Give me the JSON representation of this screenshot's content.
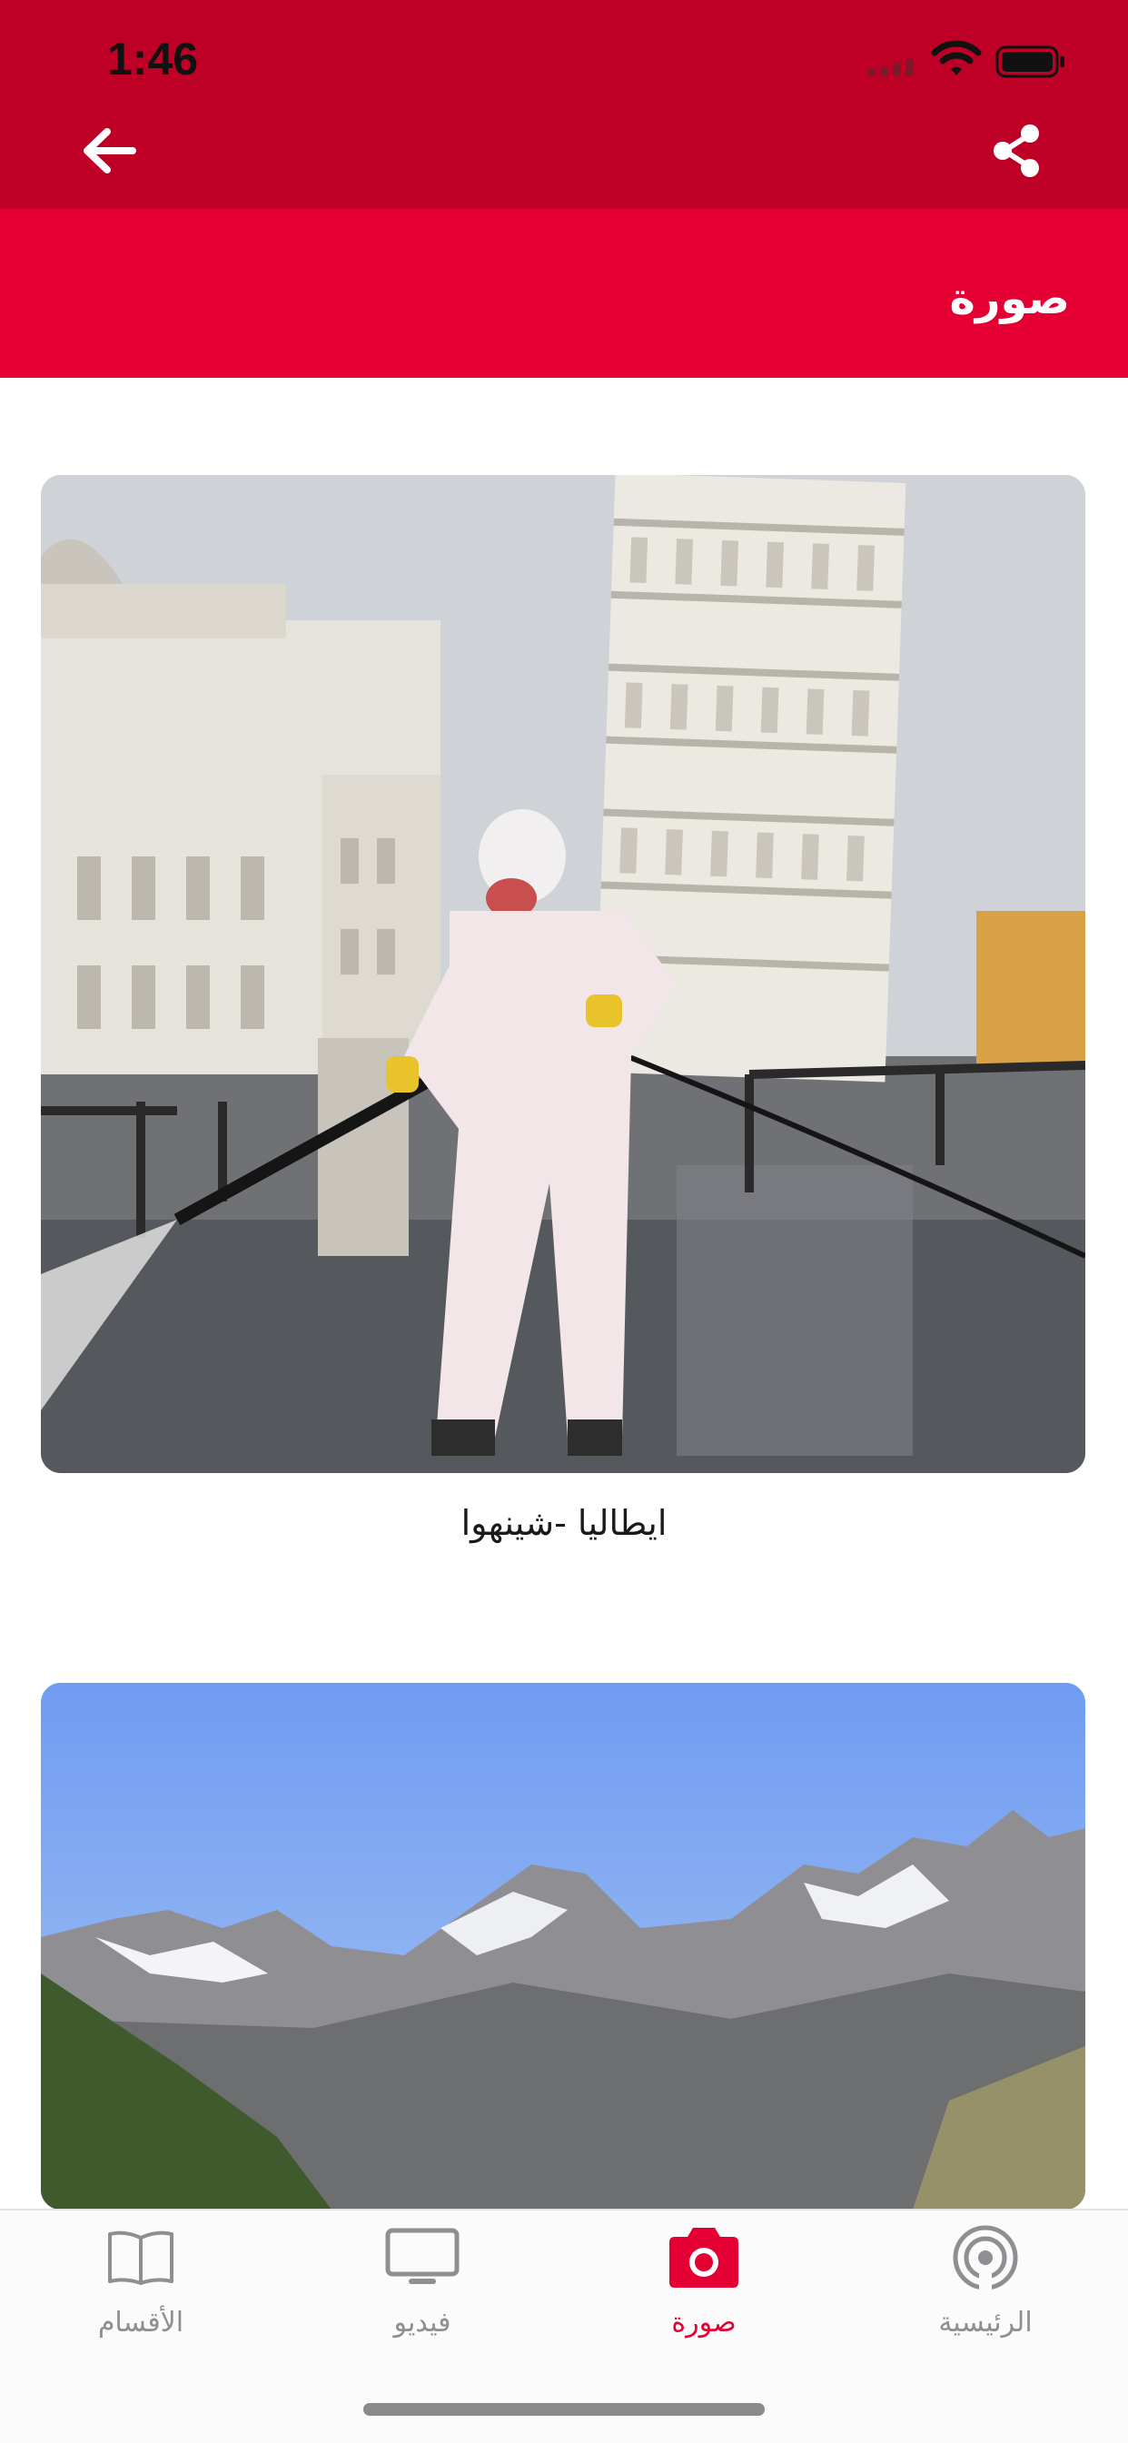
{
  "status_bar": {
    "time": "1:46"
  },
  "header": {
    "title": "صورة"
  },
  "gallery": {
    "items": [
      {
        "caption": "ايطاليا -شينهوا"
      },
      {
        "caption": ""
      }
    ]
  },
  "tab_bar": {
    "tabs": [
      {
        "label": "الأقسام",
        "icon": "book-icon",
        "active": false
      },
      {
        "label": "فيديو",
        "icon": "tv-icon",
        "active": false
      },
      {
        "label": "صورة",
        "icon": "camera-icon",
        "active": true
      },
      {
        "label": "الرئيسية",
        "icon": "broadcast-icon",
        "active": false
      }
    ]
  },
  "colors": {
    "header_dark": "#bf0026",
    "header_red": "#e40033",
    "accent": "#e40033",
    "inactive_tab": "#8e8e93"
  }
}
